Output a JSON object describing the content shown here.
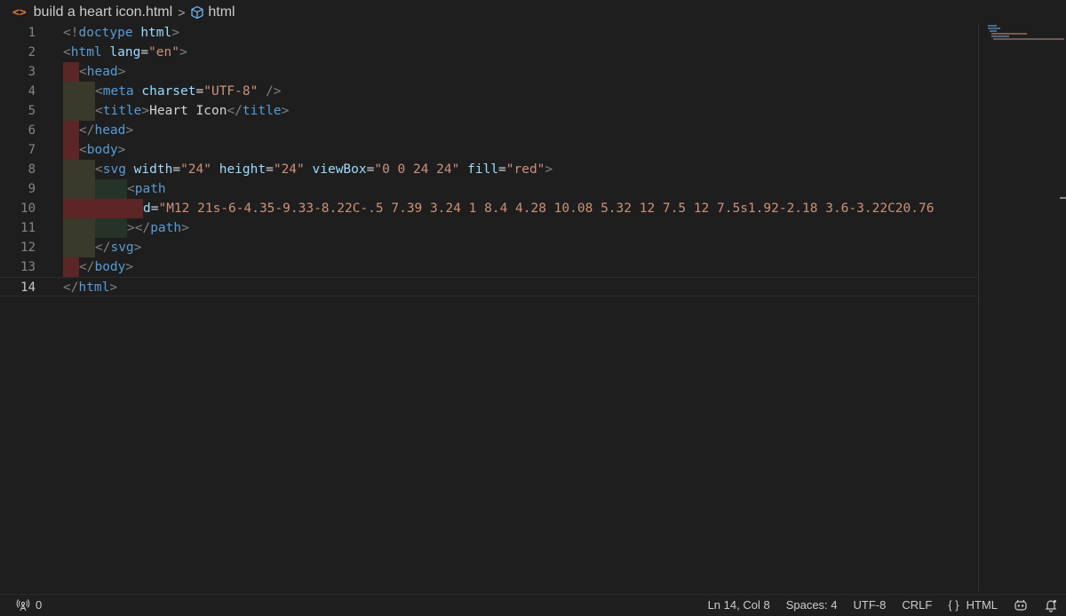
{
  "breadcrumb": {
    "html_glyph": "<>",
    "file_name": "build a heart icon.html",
    "separator": ">",
    "symbol_label": "html"
  },
  "editor": {
    "current_line": 14,
    "lines": [
      {
        "number": "1"
      },
      {
        "number": "2"
      },
      {
        "number": "3"
      },
      {
        "number": "4"
      },
      {
        "number": "5"
      },
      {
        "number": "6"
      },
      {
        "number": "7"
      },
      {
        "number": "8"
      },
      {
        "number": "9"
      },
      {
        "number": "10"
      },
      {
        "number": "11"
      },
      {
        "number": "12"
      },
      {
        "number": "13"
      },
      {
        "number": "14"
      }
    ],
    "tokens": {
      "lt": "<",
      "gt": ">",
      "lt_slash": "</",
      "self_close": " />",
      "eq": "=",
      "doctype_excl": "!",
      "doctype": "doctype",
      "html": "html",
      "lang": "lang",
      "lang_val": "\"en\"",
      "head": "head",
      "meta": "meta",
      "charset": "charset",
      "charset_val": "\"UTF-8\"",
      "title": "title",
      "title_text": "Heart Icon",
      "body": "body",
      "svg": "svg",
      "width": "width",
      "width_val": "\"24\"",
      "height": "height",
      "height_val": "\"24\"",
      "viewBox": "viewBox",
      "viewBox_val": "\"0 0 24 24\"",
      "fill": "fill",
      "fill_val": "\"red\"",
      "path": "path",
      "d": "d",
      "d_val": "\"M12 21s-6-4.35-9.33-8.22C-.5 7.39 3.24 1 8.4 4.28 10.08 5.32 12 7.5 12 7.5s1.92-2.18 3.6-3.22C20.76"
    }
  },
  "statusbar": {
    "ports": "0",
    "position": "Ln 14, Col 8",
    "spaces": "Spaces: 4",
    "encoding": "UTF-8",
    "eol": "CRLF",
    "lang_braces": "{ }",
    "language": "HTML"
  }
}
